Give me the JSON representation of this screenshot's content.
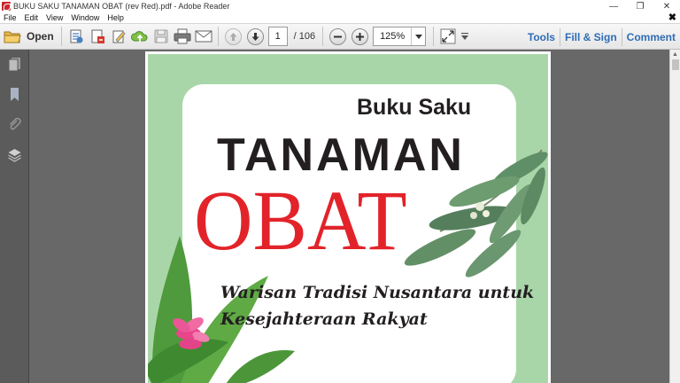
{
  "window": {
    "title": "BUKU SAKU TANAMAN OBAT (rev Red).pdf - Adobe Reader",
    "controls": [
      "—",
      "❐",
      "✕"
    ]
  },
  "menu": {
    "items": [
      "File",
      "Edit",
      "View",
      "Window",
      "Help"
    ],
    "close_doc": "✖"
  },
  "toolbar": {
    "open_label": "Open",
    "page_current": "1",
    "page_total": "/ 106",
    "zoom": "125%",
    "links": [
      "Tools",
      "Fill & Sign",
      "Comment"
    ]
  },
  "document": {
    "cover": {
      "line1": "Buku Saku",
      "line2": "TANAMAN",
      "line3": "OBAT",
      "subtitle1": "Warisan Tradisi Nusantara untuk",
      "subtitle2": "Kesejahteraan Rakyat"
    }
  },
  "colors": {
    "accent": "#2f6db6",
    "cover_bg": "#a9d6a9",
    "title_red": "#e2232a",
    "nav_bg": "#5b5b5b",
    "doc_bg": "#686868"
  }
}
